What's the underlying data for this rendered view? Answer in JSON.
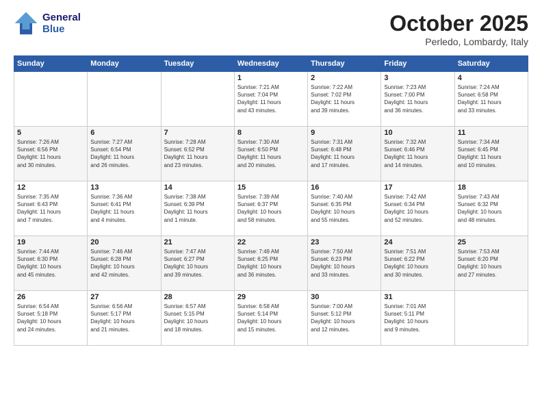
{
  "header": {
    "logo_line1": "General",
    "logo_line2": "Blue",
    "month": "October 2025",
    "location": "Perledo, Lombardy, Italy"
  },
  "weekdays": [
    "Sunday",
    "Monday",
    "Tuesday",
    "Wednesday",
    "Thursday",
    "Friday",
    "Saturday"
  ],
  "weeks": [
    [
      {
        "day": "",
        "info": ""
      },
      {
        "day": "",
        "info": ""
      },
      {
        "day": "",
        "info": ""
      },
      {
        "day": "1",
        "info": "Sunrise: 7:21 AM\nSunset: 7:04 PM\nDaylight: 11 hours\nand 43 minutes."
      },
      {
        "day": "2",
        "info": "Sunrise: 7:22 AM\nSunset: 7:02 PM\nDaylight: 11 hours\nand 39 minutes."
      },
      {
        "day": "3",
        "info": "Sunrise: 7:23 AM\nSunset: 7:00 PM\nDaylight: 11 hours\nand 36 minutes."
      },
      {
        "day": "4",
        "info": "Sunrise: 7:24 AM\nSunset: 6:58 PM\nDaylight: 11 hours\nand 33 minutes."
      }
    ],
    [
      {
        "day": "5",
        "info": "Sunrise: 7:26 AM\nSunset: 6:56 PM\nDaylight: 11 hours\nand 30 minutes."
      },
      {
        "day": "6",
        "info": "Sunrise: 7:27 AM\nSunset: 6:54 PM\nDaylight: 11 hours\nand 26 minutes."
      },
      {
        "day": "7",
        "info": "Sunrise: 7:28 AM\nSunset: 6:52 PM\nDaylight: 11 hours\nand 23 minutes."
      },
      {
        "day": "8",
        "info": "Sunrise: 7:30 AM\nSunset: 6:50 PM\nDaylight: 11 hours\nand 20 minutes."
      },
      {
        "day": "9",
        "info": "Sunrise: 7:31 AM\nSunset: 6:48 PM\nDaylight: 11 hours\nand 17 minutes."
      },
      {
        "day": "10",
        "info": "Sunrise: 7:32 AM\nSunset: 6:46 PM\nDaylight: 11 hours\nand 14 minutes."
      },
      {
        "day": "11",
        "info": "Sunrise: 7:34 AM\nSunset: 6:45 PM\nDaylight: 11 hours\nand 10 minutes."
      }
    ],
    [
      {
        "day": "12",
        "info": "Sunrise: 7:35 AM\nSunset: 6:43 PM\nDaylight: 11 hours\nand 7 minutes."
      },
      {
        "day": "13",
        "info": "Sunrise: 7:36 AM\nSunset: 6:41 PM\nDaylight: 11 hours\nand 4 minutes."
      },
      {
        "day": "14",
        "info": "Sunrise: 7:38 AM\nSunset: 6:39 PM\nDaylight: 11 hours\nand 1 minute."
      },
      {
        "day": "15",
        "info": "Sunrise: 7:39 AM\nSunset: 6:37 PM\nDaylight: 10 hours\nand 58 minutes."
      },
      {
        "day": "16",
        "info": "Sunrise: 7:40 AM\nSunset: 6:35 PM\nDaylight: 10 hours\nand 55 minutes."
      },
      {
        "day": "17",
        "info": "Sunrise: 7:42 AM\nSunset: 6:34 PM\nDaylight: 10 hours\nand 52 minutes."
      },
      {
        "day": "18",
        "info": "Sunrise: 7:43 AM\nSunset: 6:32 PM\nDaylight: 10 hours\nand 48 minutes."
      }
    ],
    [
      {
        "day": "19",
        "info": "Sunrise: 7:44 AM\nSunset: 6:30 PM\nDaylight: 10 hours\nand 45 minutes."
      },
      {
        "day": "20",
        "info": "Sunrise: 7:46 AM\nSunset: 6:28 PM\nDaylight: 10 hours\nand 42 minutes."
      },
      {
        "day": "21",
        "info": "Sunrise: 7:47 AM\nSunset: 6:27 PM\nDaylight: 10 hours\nand 39 minutes."
      },
      {
        "day": "22",
        "info": "Sunrise: 7:49 AM\nSunset: 6:25 PM\nDaylight: 10 hours\nand 36 minutes."
      },
      {
        "day": "23",
        "info": "Sunrise: 7:50 AM\nSunset: 6:23 PM\nDaylight: 10 hours\nand 33 minutes."
      },
      {
        "day": "24",
        "info": "Sunrise: 7:51 AM\nSunset: 6:22 PM\nDaylight: 10 hours\nand 30 minutes."
      },
      {
        "day": "25",
        "info": "Sunrise: 7:53 AM\nSunset: 6:20 PM\nDaylight: 10 hours\nand 27 minutes."
      }
    ],
    [
      {
        "day": "26",
        "info": "Sunrise: 6:54 AM\nSunset: 5:18 PM\nDaylight: 10 hours\nand 24 minutes."
      },
      {
        "day": "27",
        "info": "Sunrise: 6:56 AM\nSunset: 5:17 PM\nDaylight: 10 hours\nand 21 minutes."
      },
      {
        "day": "28",
        "info": "Sunrise: 6:57 AM\nSunset: 5:15 PM\nDaylight: 10 hours\nand 18 minutes."
      },
      {
        "day": "29",
        "info": "Sunrise: 6:58 AM\nSunset: 5:14 PM\nDaylight: 10 hours\nand 15 minutes."
      },
      {
        "day": "30",
        "info": "Sunrise: 7:00 AM\nSunset: 5:12 PM\nDaylight: 10 hours\nand 12 minutes."
      },
      {
        "day": "31",
        "info": "Sunrise: 7:01 AM\nSunset: 5:11 PM\nDaylight: 10 hours\nand 9 minutes."
      },
      {
        "day": "",
        "info": ""
      }
    ]
  ]
}
